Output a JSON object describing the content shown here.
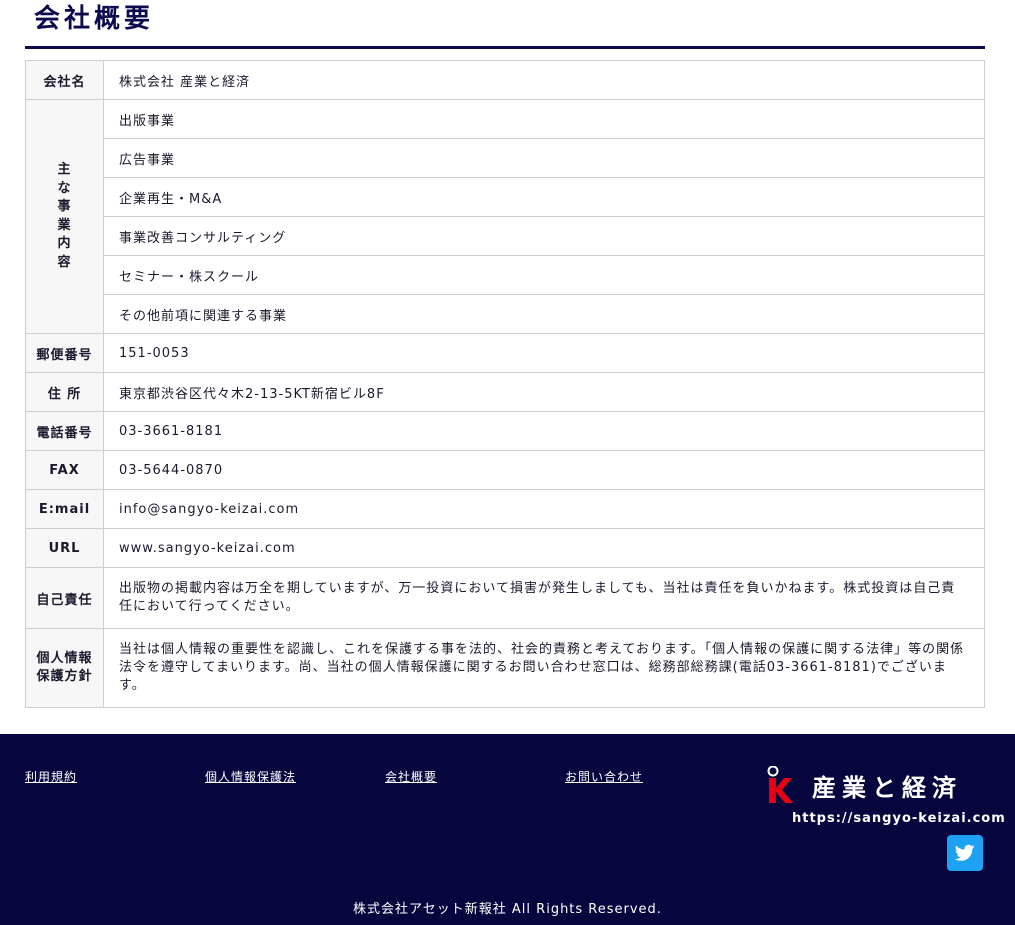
{
  "page_title": "会社概要",
  "rows": {
    "company_name": {
      "label": "会社名",
      "value": "株式会社 産業と経済"
    },
    "business": {
      "label": "主な事業内容",
      "items": [
        "出版事業",
        "広告事業",
        "企業再生・M&A",
        "事業改善コンサルティング",
        "セミナー・株スクール",
        "その他前項に関連する事業"
      ]
    },
    "postal": {
      "label": "郵便番号",
      "value": "151-0053"
    },
    "address": {
      "label": "住 所",
      "value": "東京都渋谷区代々木2-13-5KT新宿ビル8F"
    },
    "phone": {
      "label": "電話番号",
      "value": "03-3661-8181"
    },
    "fax": {
      "label": "FAX",
      "value": "03-5644-0870"
    },
    "email": {
      "label": "E:mail",
      "value": "info@sangyo-keizai.com"
    },
    "url": {
      "label": "URL",
      "value": "www.sangyo-keizai.com"
    },
    "disclaimer": {
      "label": "自己責任",
      "value": "出版物の掲載内容は万全を期していますが、万一投資において損害が発生しましても、当社は責任を負いかねます。株式投資は自己責任において行ってください。"
    },
    "privacy": {
      "label_line1": "個人情報",
      "label_line2": "保護方針",
      "value": "当社は個人情報の重要性を認識し、これを保護する事を法的、社会的責務と考えております。「個人情報の保護に関する法律」等の関係法令を遵守してまいります。尚、当社の個人情報保護に関するお問い合わせ窓口は、総務部総務課(電話03-3661-8181)でございます。"
    }
  },
  "footer": {
    "links": [
      "利用規約",
      "個人情報保護法",
      "会社概要",
      "お問い合わせ"
    ],
    "logo_text": "産業と経済",
    "logo_url": "https://sangyo-keizai.com",
    "copyright": "株式会社アセット新報社 All Rights Reserved.",
    "colors": {
      "background": "#06063f",
      "twitter": "#1da1f2",
      "logo_red": "#e60012"
    }
  }
}
